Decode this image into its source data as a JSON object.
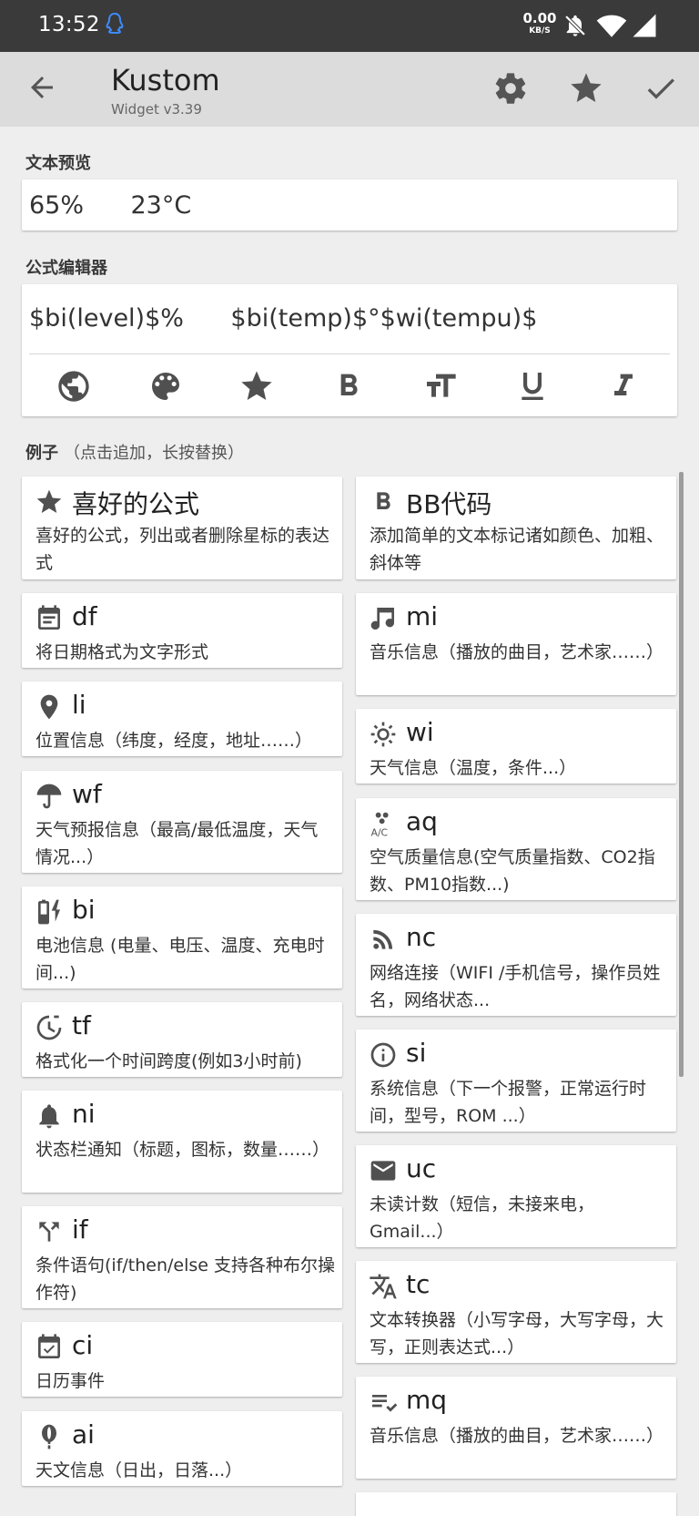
{
  "status_bar": {
    "time": "13:52",
    "net_speed": "0.00",
    "net_unit": "KB/S"
  },
  "app_bar": {
    "title": "Kustom",
    "subtitle": "Widget v3.39"
  },
  "preview": {
    "label": "文本预览",
    "text": "65%      23°C"
  },
  "editor": {
    "label": "公式编辑器",
    "formula": "$bi(level)$%      $bi(temp)$°$wi(tempu)$"
  },
  "examples_section": {
    "label": "例子",
    "hint": "（点击追加，长按替换）"
  },
  "examples_left": [
    {
      "icon": "star-icon",
      "name": "喜好的公式",
      "desc": "喜好的公式，列出或者删除星标的表达式"
    },
    {
      "icon": "calendar-icon",
      "name": "df",
      "desc": "将日期格式为文字形式"
    },
    {
      "icon": "location-icon",
      "name": "li",
      "desc": "位置信息（纬度，经度，地址……）"
    },
    {
      "icon": "umbrella-icon",
      "name": "wf",
      "desc": "天气预报信息（最高/最低温度，天气情况...）"
    },
    {
      "icon": "battery-charging-icon",
      "name": "bi",
      "desc": "电池信息 (电量、电压、温度、充电时间...)"
    },
    {
      "icon": "timer-icon",
      "name": "tf",
      "desc": "格式化一个时间跨度(例如3小时前)"
    },
    {
      "icon": "bell-icon",
      "name": "ni",
      "desc": "状态栏通知（标题，图标，数量……）"
    },
    {
      "icon": "fork-icon",
      "name": "if",
      "desc": "条件语句(if/then/else 支持各种布尔操作符)"
    },
    {
      "icon": "calendar-check-icon",
      "name": "ci",
      "desc": "日历事件"
    },
    {
      "icon": "balloon-icon",
      "name": "ai",
      "desc": "天文信息（日出，日落...）"
    }
  ],
  "examples_right": [
    {
      "icon": "bold-icon",
      "name": "BB代码",
      "desc": "添加简单的文本标记诸如颜色、加粗、斜体等"
    },
    {
      "icon": "music-note-icon",
      "name": "mi",
      "desc": "音乐信息（播放的曲目，艺术家……）"
    },
    {
      "icon": "sun-icon",
      "name": "wi",
      "desc": "天气信息（温度，条件...）"
    },
    {
      "icon": "air-quality-icon",
      "name": "aq",
      "desc": "空气质量信息(空气质量指数、CO2指数、PM10指数...)"
    },
    {
      "icon": "rss-icon",
      "name": "nc",
      "desc": "网络连接（WIFI /手机信号，操作员姓名，网络状态..."
    },
    {
      "icon": "info-icon",
      "name": "si",
      "desc": "系统信息（下一个报警，正常运行时间，型号，ROM ...）"
    },
    {
      "icon": "mail-icon",
      "name": "uc",
      "desc": "未读计数（短信，未接来电，Gmail...）"
    },
    {
      "icon": "translate-icon",
      "name": "tc",
      "desc": "文本转换器（小写字母，大写字母，大写，正则表达式...）"
    },
    {
      "icon": "playlist-check-icon",
      "name": "mq",
      "desc": "音乐信息（播放的曲目，艺术家……）"
    }
  ]
}
